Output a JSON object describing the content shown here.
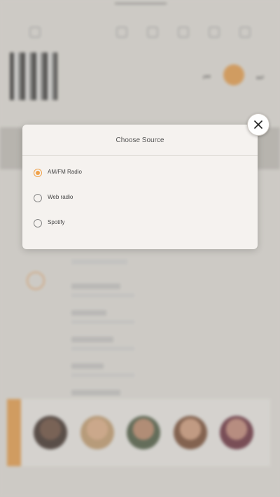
{
  "dialog": {
    "title": "Choose Source",
    "options": [
      {
        "label": "AM/FM Radio",
        "selected": true
      },
      {
        "label": "Web radio",
        "selected": false
      },
      {
        "label": "Spotify",
        "selected": false
      }
    ],
    "close_icon": "close-icon"
  },
  "colors": {
    "accent": "#f0a24b",
    "dialog_bg": "#f5f2ef",
    "page_bg": "#ece9e4"
  }
}
